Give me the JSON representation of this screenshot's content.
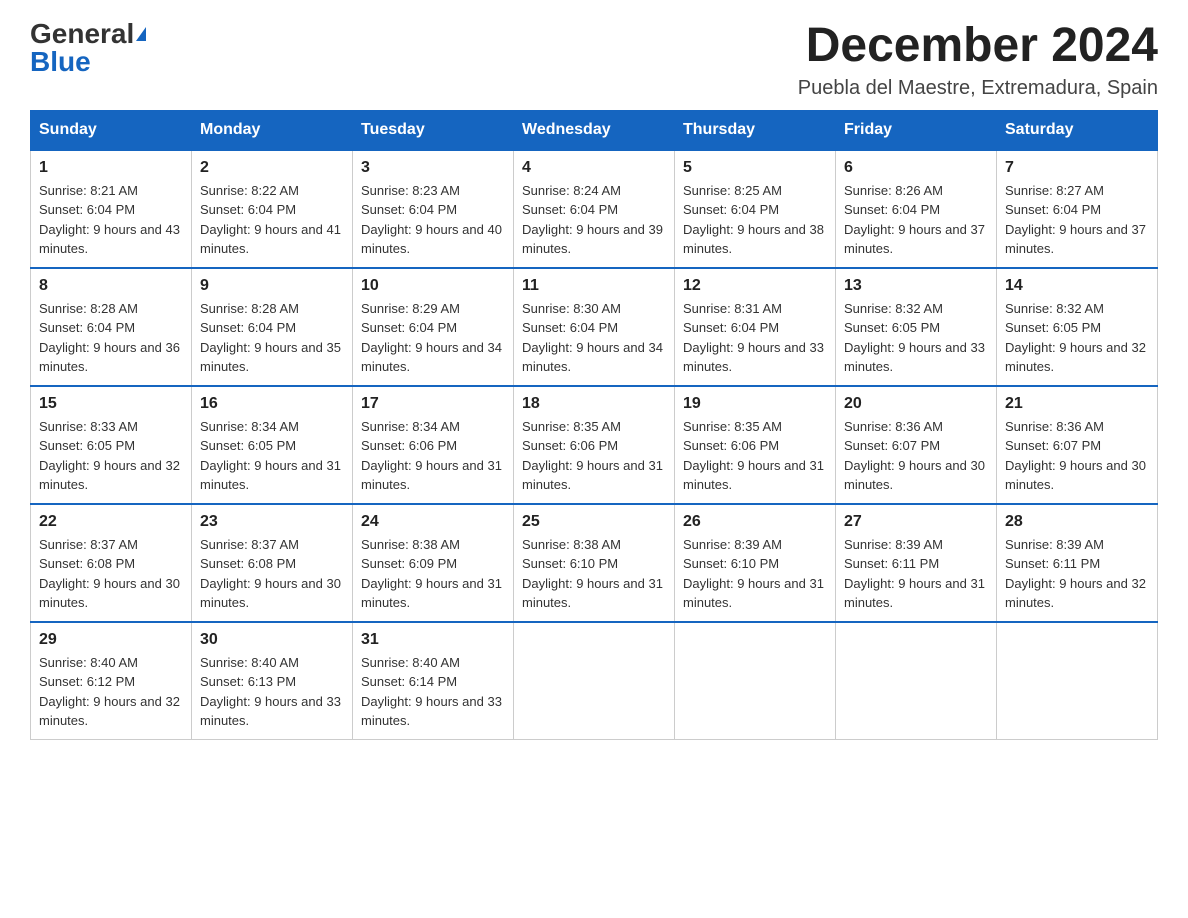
{
  "logo": {
    "general": "General",
    "blue": "Blue"
  },
  "header": {
    "title": "December 2024",
    "subtitle": "Puebla del Maestre, Extremadura, Spain"
  },
  "weekdays": [
    "Sunday",
    "Monday",
    "Tuesday",
    "Wednesday",
    "Thursday",
    "Friday",
    "Saturday"
  ],
  "weeks": [
    [
      {
        "day": "1",
        "sunrise": "8:21 AM",
        "sunset": "6:04 PM",
        "daylight": "9 hours and 43 minutes."
      },
      {
        "day": "2",
        "sunrise": "8:22 AM",
        "sunset": "6:04 PM",
        "daylight": "9 hours and 41 minutes."
      },
      {
        "day": "3",
        "sunrise": "8:23 AM",
        "sunset": "6:04 PM",
        "daylight": "9 hours and 40 minutes."
      },
      {
        "day": "4",
        "sunrise": "8:24 AM",
        "sunset": "6:04 PM",
        "daylight": "9 hours and 39 minutes."
      },
      {
        "day": "5",
        "sunrise": "8:25 AM",
        "sunset": "6:04 PM",
        "daylight": "9 hours and 38 minutes."
      },
      {
        "day": "6",
        "sunrise": "8:26 AM",
        "sunset": "6:04 PM",
        "daylight": "9 hours and 37 minutes."
      },
      {
        "day": "7",
        "sunrise": "8:27 AM",
        "sunset": "6:04 PM",
        "daylight": "9 hours and 37 minutes."
      }
    ],
    [
      {
        "day": "8",
        "sunrise": "8:28 AM",
        "sunset": "6:04 PM",
        "daylight": "9 hours and 36 minutes."
      },
      {
        "day": "9",
        "sunrise": "8:28 AM",
        "sunset": "6:04 PM",
        "daylight": "9 hours and 35 minutes."
      },
      {
        "day": "10",
        "sunrise": "8:29 AM",
        "sunset": "6:04 PM",
        "daylight": "9 hours and 34 minutes."
      },
      {
        "day": "11",
        "sunrise": "8:30 AM",
        "sunset": "6:04 PM",
        "daylight": "9 hours and 34 minutes."
      },
      {
        "day": "12",
        "sunrise": "8:31 AM",
        "sunset": "6:04 PM",
        "daylight": "9 hours and 33 minutes."
      },
      {
        "day": "13",
        "sunrise": "8:32 AM",
        "sunset": "6:05 PM",
        "daylight": "9 hours and 33 minutes."
      },
      {
        "day": "14",
        "sunrise": "8:32 AM",
        "sunset": "6:05 PM",
        "daylight": "9 hours and 32 minutes."
      }
    ],
    [
      {
        "day": "15",
        "sunrise": "8:33 AM",
        "sunset": "6:05 PM",
        "daylight": "9 hours and 32 minutes."
      },
      {
        "day": "16",
        "sunrise": "8:34 AM",
        "sunset": "6:05 PM",
        "daylight": "9 hours and 31 minutes."
      },
      {
        "day": "17",
        "sunrise": "8:34 AM",
        "sunset": "6:06 PM",
        "daylight": "9 hours and 31 minutes."
      },
      {
        "day": "18",
        "sunrise": "8:35 AM",
        "sunset": "6:06 PM",
        "daylight": "9 hours and 31 minutes."
      },
      {
        "day": "19",
        "sunrise": "8:35 AM",
        "sunset": "6:06 PM",
        "daylight": "9 hours and 31 minutes."
      },
      {
        "day": "20",
        "sunrise": "8:36 AM",
        "sunset": "6:07 PM",
        "daylight": "9 hours and 30 minutes."
      },
      {
        "day": "21",
        "sunrise": "8:36 AM",
        "sunset": "6:07 PM",
        "daylight": "9 hours and 30 minutes."
      }
    ],
    [
      {
        "day": "22",
        "sunrise": "8:37 AM",
        "sunset": "6:08 PM",
        "daylight": "9 hours and 30 minutes."
      },
      {
        "day": "23",
        "sunrise": "8:37 AM",
        "sunset": "6:08 PM",
        "daylight": "9 hours and 30 minutes."
      },
      {
        "day": "24",
        "sunrise": "8:38 AM",
        "sunset": "6:09 PM",
        "daylight": "9 hours and 31 minutes."
      },
      {
        "day": "25",
        "sunrise": "8:38 AM",
        "sunset": "6:10 PM",
        "daylight": "9 hours and 31 minutes."
      },
      {
        "day": "26",
        "sunrise": "8:39 AM",
        "sunset": "6:10 PM",
        "daylight": "9 hours and 31 minutes."
      },
      {
        "day": "27",
        "sunrise": "8:39 AM",
        "sunset": "6:11 PM",
        "daylight": "9 hours and 31 minutes."
      },
      {
        "day": "28",
        "sunrise": "8:39 AM",
        "sunset": "6:11 PM",
        "daylight": "9 hours and 32 minutes."
      }
    ],
    [
      {
        "day": "29",
        "sunrise": "8:40 AM",
        "sunset": "6:12 PM",
        "daylight": "9 hours and 32 minutes."
      },
      {
        "day": "30",
        "sunrise": "8:40 AM",
        "sunset": "6:13 PM",
        "daylight": "9 hours and 33 minutes."
      },
      {
        "day": "31",
        "sunrise": "8:40 AM",
        "sunset": "6:14 PM",
        "daylight": "9 hours and 33 minutes."
      },
      null,
      null,
      null,
      null
    ]
  ],
  "labels": {
    "sunrise": "Sunrise:",
    "sunset": "Sunset:",
    "daylight": "Daylight:"
  }
}
